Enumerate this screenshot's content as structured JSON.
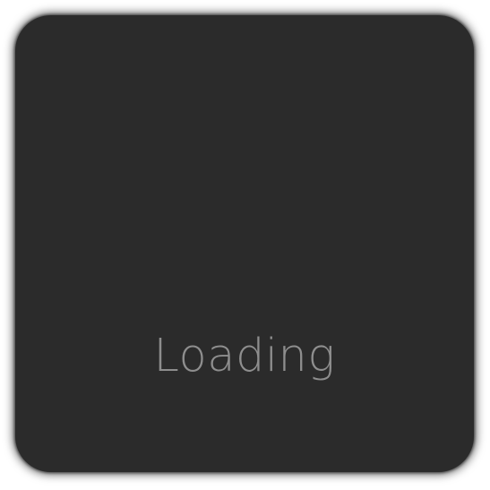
{
  "panel": {
    "status_text": "Loading"
  },
  "colors": {
    "panel_background": "#2b2b2b",
    "text": "#8e8e8e",
    "page_background": "#ffffff"
  }
}
